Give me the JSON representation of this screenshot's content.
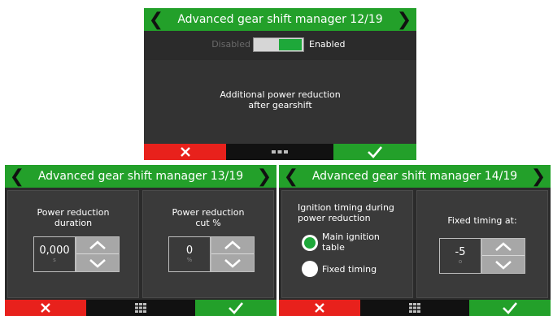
{
  "screens": [
    {
      "title": "Advanced gear shift manager 12/19",
      "toggle": {
        "off_label": "Disabled",
        "on_label": "Enabled",
        "state": "enabled"
      },
      "description": "Additional power reduction\nafter gearshift"
    },
    {
      "title": "Advanced gear shift manager 13/19",
      "fields": [
        {
          "label": "Power reduction\nduration",
          "value": "0,000",
          "unit": "s"
        },
        {
          "label": "Power reduction\ncut %",
          "value": "0",
          "unit": "%"
        }
      ]
    },
    {
      "title": "Advanced gear shift manager 14/19",
      "ignition": {
        "label": "Ignition timing during\npower reduction",
        "options": [
          "Main ignition\ntable",
          "Fixed timing"
        ],
        "selected": "Main ignition table"
      },
      "fixed": {
        "label": "Fixed timing at:",
        "value": "-5",
        "unit": "o"
      }
    }
  ],
  "icons": {
    "prev": "chevron-left-icon",
    "next": "chevron-right-icon",
    "cancel": "close-icon",
    "confirm": "check-icon",
    "menu": "menu-dots-icon",
    "up": "chevron-up-icon",
    "down": "chevron-down-icon"
  },
  "colors": {
    "title_bar": "#23a02a",
    "cancel": "#e8211c",
    "confirm": "#23a02a",
    "screen_bg": "#2b2b2b",
    "panel_bg": "#3a3a3a",
    "stepper": "#a7a7a7",
    "radio_selected": "#1ea83a"
  }
}
